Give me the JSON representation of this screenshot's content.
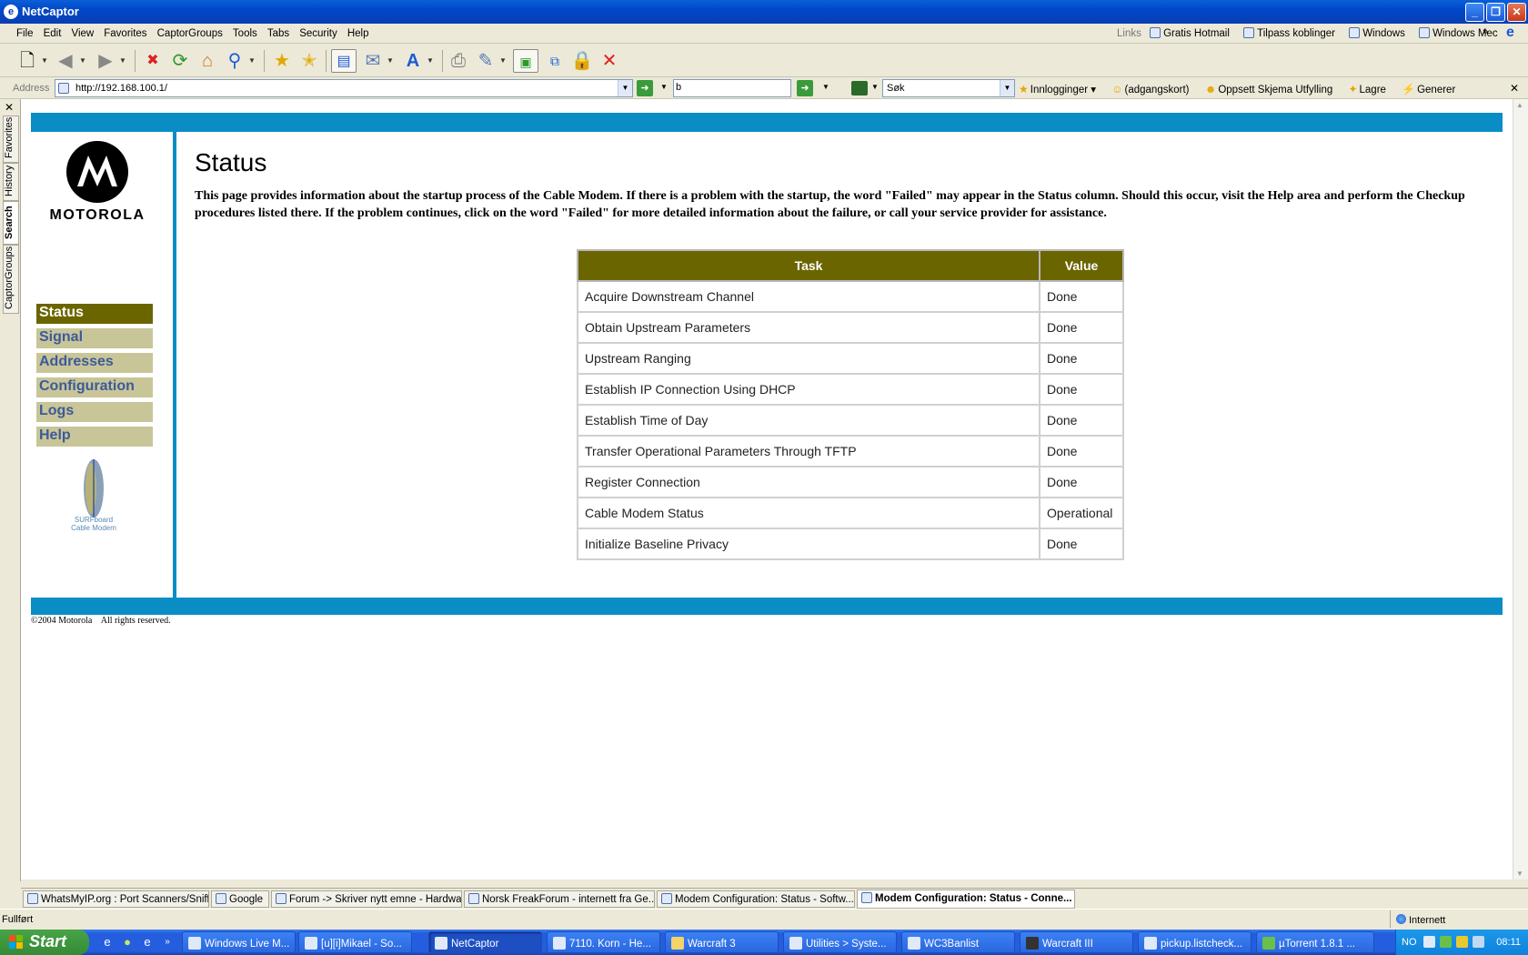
{
  "window": {
    "title": "NetCaptor"
  },
  "menu": {
    "items": [
      "File",
      "Edit",
      "View",
      "Favorites",
      "CaptorGroups",
      "Tools",
      "Tabs",
      "Security",
      "Help"
    ],
    "links_label": "Links",
    "links": [
      "Gratis Hotmail",
      "Tilpass koblinger",
      "Windows",
      "Windows Mec"
    ]
  },
  "address_bar": {
    "label": "Address",
    "url": "http://192.168.100.1/",
    "search_value": "b",
    "engine_value": "Søk",
    "links": [
      "Innlogginger",
      "(adgangskort)",
      "Oppsett Skjema Utfylling",
      "Lagre",
      "Generer"
    ]
  },
  "sidebar_tabs": [
    "Favorites",
    "History",
    "Search",
    "CaptorGroups"
  ],
  "page": {
    "brand": "MOTOROLA",
    "nav": [
      "Status",
      "Signal",
      "Addresses",
      "Configuration",
      "Logs",
      "Help"
    ],
    "nav_active": "Status",
    "surf_line1": "SURFboard",
    "surf_line2": "Cable Modem",
    "title": "Status",
    "description": "This page provides information about the startup process of the Cable Modem. If there is a problem with the startup, the word \"Failed\" may appear in the Status column. Should this occur, visit the Help area and perform the Checkup procedures listed there. If the problem continues, click on the word \"Failed\" for more detailed information about the failure, or call your service provider for assistance.",
    "table": {
      "headers": [
        "Task",
        "Value"
      ],
      "rows": [
        [
          "Acquire Downstream Channel",
          "Done"
        ],
        [
          "Obtain Upstream Parameters",
          "Done"
        ],
        [
          "Upstream Ranging",
          "Done"
        ],
        [
          "Establish IP Connection Using DHCP",
          "Done"
        ],
        [
          "Establish Time of Day",
          "Done"
        ],
        [
          "Transfer Operational Parameters Through TFTP",
          "Done"
        ],
        [
          "Register Connection",
          "Done"
        ],
        [
          "Cable Modem Status",
          "Operational"
        ],
        [
          "Initialize Baseline Privacy",
          "Done"
        ]
      ]
    },
    "copyright": "©2004 Motorola    All rights reserved."
  },
  "doc_tabs": [
    "WhatsMyIP.org : Port Scanners/Sniff...",
    "Google",
    "Forum -> Skriver nytt emne - Hardwa...",
    "Norsk FreakForum - internett fra Ge...",
    "Modem Configuration: Status - Softw...",
    "Modem Configuration: Status - Conne..."
  ],
  "status_bar": {
    "text": "Fullført",
    "zone": "Internett"
  },
  "taskbar": {
    "start": "Start",
    "buttons": [
      "Windows Live M...",
      "[u][i]Mikael - So...",
      "NetCaptor",
      "7110. Korn - He...",
      "Warcraft 3",
      "Utilities > Syste...",
      "WC3Banlist",
      "Warcraft III",
      "pickup.listcheck...",
      "µTorrent 1.8.1 ..."
    ],
    "active": "NetCaptor",
    "lang": "NO",
    "clock": "08:11"
  },
  "colors": {
    "band_blue": "#0a8dc4",
    "nav_olive": "#6b6500",
    "nav_khaki": "#c8c598",
    "nav_text": "#3d5a9a"
  }
}
